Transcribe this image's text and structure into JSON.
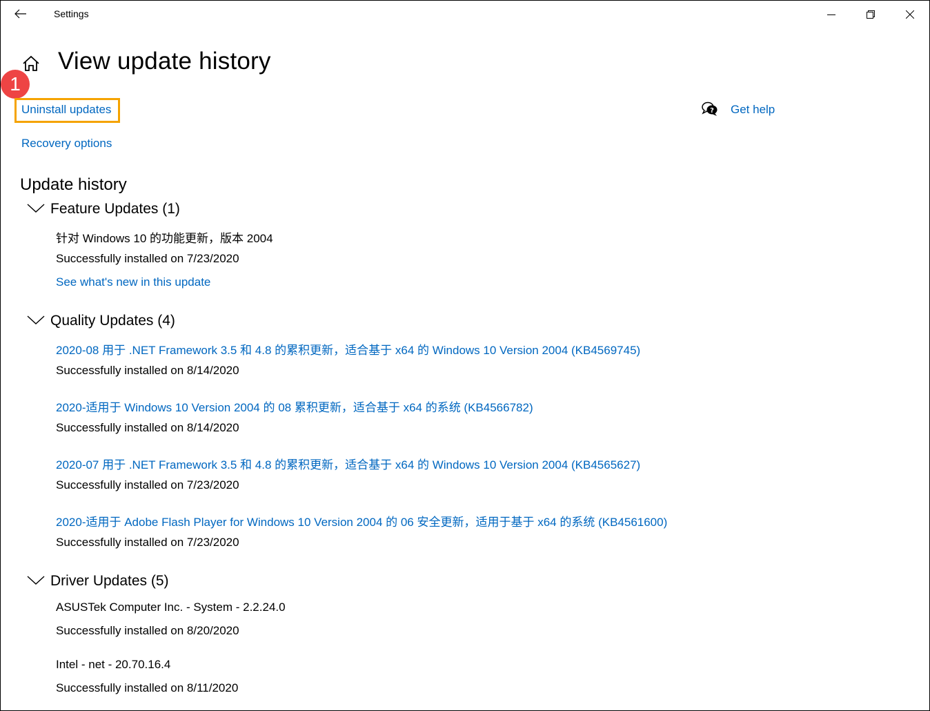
{
  "window": {
    "title": "Settings",
    "controls": {
      "minimize": "minimize",
      "maximize": "restore",
      "close": "close"
    }
  },
  "page": {
    "title": "View update history",
    "annotation_badge": "1",
    "links": {
      "uninstall": "Uninstall updates",
      "recovery": "Recovery options",
      "help": "Get help"
    },
    "section_title": "Update history"
  },
  "groups": [
    {
      "label": "Feature Updates (1)",
      "items": [
        {
          "name": "针对 Windows 10 的功能更新，版本 2004",
          "name_is_link": false,
          "status": "Successfully installed on 7/23/2020",
          "extra_link": "See what's new in this update"
        }
      ]
    },
    {
      "label": "Quality Updates (4)",
      "items": [
        {
          "name": "2020-08 用于 .NET Framework 3.5 和 4.8 的累积更新，适合基于 x64 的 Windows 10 Version 2004 (KB4569745)",
          "name_is_link": true,
          "status": "Successfully installed on 8/14/2020"
        },
        {
          "name": "2020-适用于 Windows 10 Version 2004 的 08 累积更新，适合基于 x64 的系统 (KB4566782)",
          "name_is_link": true,
          "status": "Successfully installed on 8/14/2020"
        },
        {
          "name": "2020-07 用于 .NET Framework 3.5 和 4.8 的累积更新，适合基于 x64 的 Windows 10 Version 2004 (KB4565627)",
          "name_is_link": true,
          "status": "Successfully installed on 7/23/2020"
        },
        {
          "name": "2020-适用于 Adobe Flash Player for Windows 10 Version 2004 的 06 安全更新，适用于基于 x64 的系统 (KB4561600)",
          "name_is_link": true,
          "status": "Successfully installed on 7/23/2020"
        }
      ]
    },
    {
      "label": "Driver Updates (5)",
      "items": [
        {
          "name": "ASUSTek Computer Inc. - System - 2.2.24.0",
          "name_is_link": false,
          "status": "Successfully installed on 8/20/2020"
        },
        {
          "name": "Intel - net - 20.70.16.4",
          "name_is_link": false,
          "status": "Successfully installed on 8/11/2020"
        }
      ]
    }
  ],
  "colors": {
    "link": "#0067c0",
    "highlight_box": "#f5a300",
    "badge": "#ee4444"
  }
}
